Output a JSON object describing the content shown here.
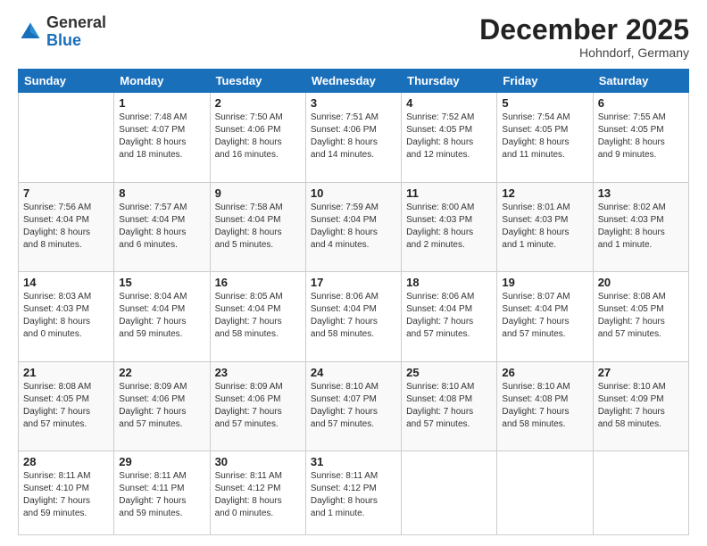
{
  "header": {
    "logo": {
      "general": "General",
      "blue": "Blue"
    },
    "title": "December 2025",
    "subtitle": "Hohndorf, Germany"
  },
  "calendar": {
    "days_of_week": [
      "Sunday",
      "Monday",
      "Tuesday",
      "Wednesday",
      "Thursday",
      "Friday",
      "Saturday"
    ],
    "weeks": [
      [
        {
          "day": "",
          "info": ""
        },
        {
          "day": "1",
          "info": "Sunrise: 7:48 AM\nSunset: 4:07 PM\nDaylight: 8 hours\nand 18 minutes."
        },
        {
          "day": "2",
          "info": "Sunrise: 7:50 AM\nSunset: 4:06 PM\nDaylight: 8 hours\nand 16 minutes."
        },
        {
          "day": "3",
          "info": "Sunrise: 7:51 AM\nSunset: 4:06 PM\nDaylight: 8 hours\nand 14 minutes."
        },
        {
          "day": "4",
          "info": "Sunrise: 7:52 AM\nSunset: 4:05 PM\nDaylight: 8 hours\nand 12 minutes."
        },
        {
          "day": "5",
          "info": "Sunrise: 7:54 AM\nSunset: 4:05 PM\nDaylight: 8 hours\nand 11 minutes."
        },
        {
          "day": "6",
          "info": "Sunrise: 7:55 AM\nSunset: 4:05 PM\nDaylight: 8 hours\nand 9 minutes."
        }
      ],
      [
        {
          "day": "7",
          "info": "Sunrise: 7:56 AM\nSunset: 4:04 PM\nDaylight: 8 hours\nand 8 minutes."
        },
        {
          "day": "8",
          "info": "Sunrise: 7:57 AM\nSunset: 4:04 PM\nDaylight: 8 hours\nand 6 minutes."
        },
        {
          "day": "9",
          "info": "Sunrise: 7:58 AM\nSunset: 4:04 PM\nDaylight: 8 hours\nand 5 minutes."
        },
        {
          "day": "10",
          "info": "Sunrise: 7:59 AM\nSunset: 4:04 PM\nDaylight: 8 hours\nand 4 minutes."
        },
        {
          "day": "11",
          "info": "Sunrise: 8:00 AM\nSunset: 4:03 PM\nDaylight: 8 hours\nand 2 minutes."
        },
        {
          "day": "12",
          "info": "Sunrise: 8:01 AM\nSunset: 4:03 PM\nDaylight: 8 hours\nand 1 minute."
        },
        {
          "day": "13",
          "info": "Sunrise: 8:02 AM\nSunset: 4:03 PM\nDaylight: 8 hours\nand 1 minute."
        }
      ],
      [
        {
          "day": "14",
          "info": "Sunrise: 8:03 AM\nSunset: 4:03 PM\nDaylight: 8 hours\nand 0 minutes."
        },
        {
          "day": "15",
          "info": "Sunrise: 8:04 AM\nSunset: 4:04 PM\nDaylight: 7 hours\nand 59 minutes."
        },
        {
          "day": "16",
          "info": "Sunrise: 8:05 AM\nSunset: 4:04 PM\nDaylight: 7 hours\nand 58 minutes."
        },
        {
          "day": "17",
          "info": "Sunrise: 8:06 AM\nSunset: 4:04 PM\nDaylight: 7 hours\nand 58 minutes."
        },
        {
          "day": "18",
          "info": "Sunrise: 8:06 AM\nSunset: 4:04 PM\nDaylight: 7 hours\nand 57 minutes."
        },
        {
          "day": "19",
          "info": "Sunrise: 8:07 AM\nSunset: 4:04 PM\nDaylight: 7 hours\nand 57 minutes."
        },
        {
          "day": "20",
          "info": "Sunrise: 8:08 AM\nSunset: 4:05 PM\nDaylight: 7 hours\nand 57 minutes."
        }
      ],
      [
        {
          "day": "21",
          "info": "Sunrise: 8:08 AM\nSunset: 4:05 PM\nDaylight: 7 hours\nand 57 minutes."
        },
        {
          "day": "22",
          "info": "Sunrise: 8:09 AM\nSunset: 4:06 PM\nDaylight: 7 hours\nand 57 minutes."
        },
        {
          "day": "23",
          "info": "Sunrise: 8:09 AM\nSunset: 4:06 PM\nDaylight: 7 hours\nand 57 minutes."
        },
        {
          "day": "24",
          "info": "Sunrise: 8:10 AM\nSunset: 4:07 PM\nDaylight: 7 hours\nand 57 minutes."
        },
        {
          "day": "25",
          "info": "Sunrise: 8:10 AM\nSunset: 4:08 PM\nDaylight: 7 hours\nand 57 minutes."
        },
        {
          "day": "26",
          "info": "Sunrise: 8:10 AM\nSunset: 4:08 PM\nDaylight: 7 hours\nand 58 minutes."
        },
        {
          "day": "27",
          "info": "Sunrise: 8:10 AM\nSunset: 4:09 PM\nDaylight: 7 hours\nand 58 minutes."
        }
      ],
      [
        {
          "day": "28",
          "info": "Sunrise: 8:11 AM\nSunset: 4:10 PM\nDaylight: 7 hours\nand 59 minutes."
        },
        {
          "day": "29",
          "info": "Sunrise: 8:11 AM\nSunset: 4:11 PM\nDaylight: 7 hours\nand 59 minutes."
        },
        {
          "day": "30",
          "info": "Sunrise: 8:11 AM\nSunset: 4:12 PM\nDaylight: 8 hours\nand 0 minutes."
        },
        {
          "day": "31",
          "info": "Sunrise: 8:11 AM\nSunset: 4:12 PM\nDaylight: 8 hours\nand 1 minute."
        },
        {
          "day": "",
          "info": ""
        },
        {
          "day": "",
          "info": ""
        },
        {
          "day": "",
          "info": ""
        }
      ]
    ]
  }
}
